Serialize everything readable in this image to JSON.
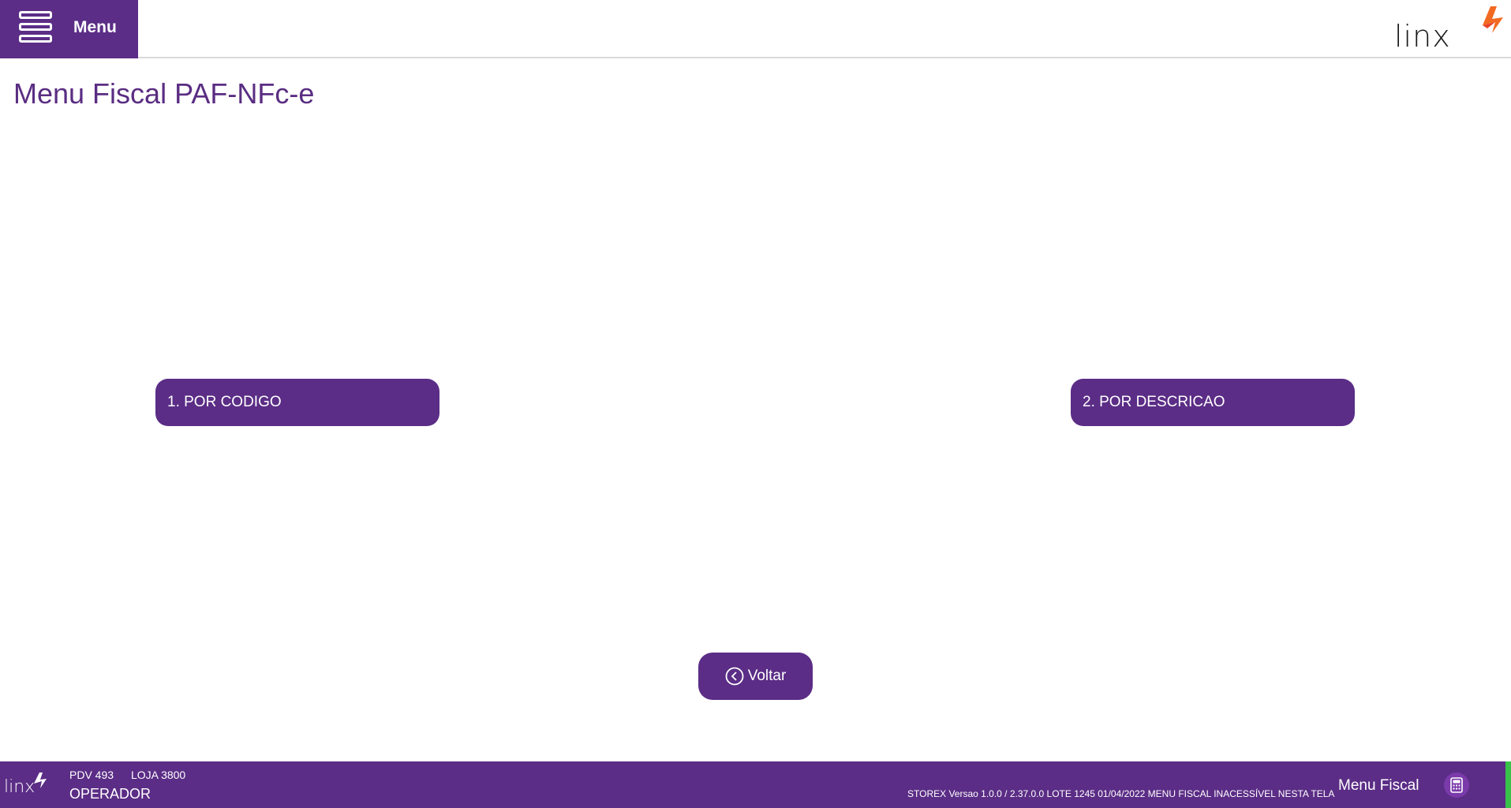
{
  "header": {
    "menu_label": "Menu",
    "logo_text": "linx"
  },
  "main": {
    "title": "Menu Fiscal PAF-NFc-e",
    "options": [
      {
        "label": "1. POR CODIGO"
      },
      {
        "label": "2. POR DESCRICAO"
      }
    ],
    "back_label": "Voltar"
  },
  "footer": {
    "logo_text": "linx",
    "pdv_label": "PDV 493",
    "loja_label": "LOJA 3800",
    "operator": "OPERADOR",
    "status": "STOREX Versao 1.0.0 / 2.37.0.0 LOTE 1245 01/04/2022 MENU FISCAL INACESSÍVEL NESTA TELA",
    "screen_name": "Menu Fiscal"
  },
  "colors": {
    "brand_purple": "#5b2d86",
    "logo_orange": "#f26a21",
    "status_green": "#38c24a"
  },
  "icons": [
    "hamburger-icon",
    "chevron-left-circle-icon",
    "calculator-icon",
    "linx-logo"
  ]
}
